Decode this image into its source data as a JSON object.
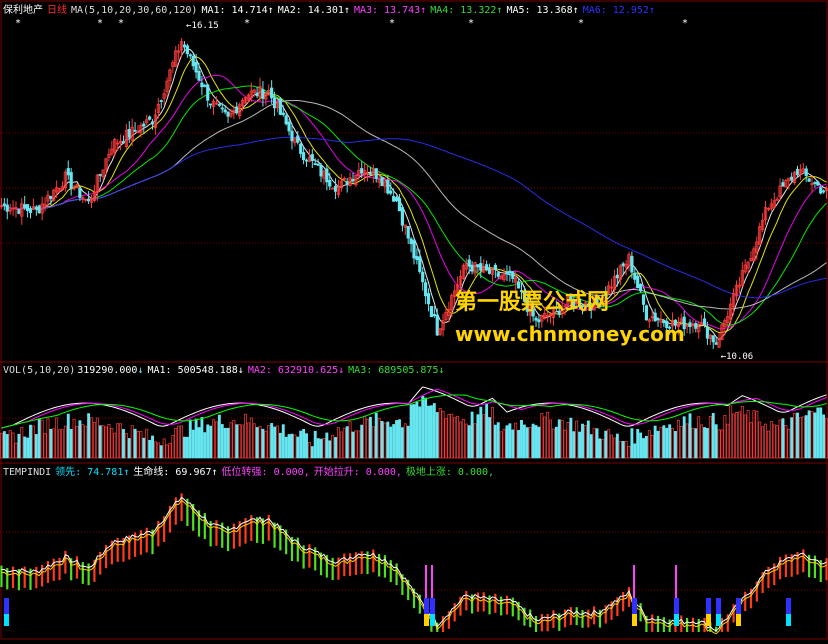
{
  "colors": {
    "background": "#000000",
    "grid": "#7a0000",
    "up": "#ff3b3b",
    "down": "#66e6f0",
    "ma5": "#ffffff",
    "ma10": "#ffff00",
    "ma20": "#ff00ff",
    "ma30": "#00ff00",
    "ma60": "#cccccc",
    "ma120": "#3030ff",
    "vol_up": "#ff3b3b",
    "vol_down": "#66e6f0",
    "ind_red": "#ff3b1a",
    "ind_green": "#50e020",
    "ind_yellow": "#ffd000",
    "white": "#ffffff",
    "cyan": "#00e0ff",
    "magenta": "#ff40ff",
    "green": "#33dd33",
    "watermark": "#ffd400"
  },
  "price_panel": {
    "stock_name": "保利地产",
    "period": "日线",
    "ma_label": "MA(5,10,20,30,60,120)",
    "ma_values": [
      {
        "label": "MA1:",
        "value": "14.714",
        "arrow": "↑",
        "color": "#ffffff"
      },
      {
        "label": "MA2:",
        "value": "14.301",
        "arrow": "↑",
        "color": "#ffffff"
      },
      {
        "label": "MA3:",
        "value": "13.743",
        "arrow": "↑",
        "color": "#ff40ff"
      },
      {
        "label": "MA4:",
        "value": "13.322",
        "arrow": "↑",
        "color": "#33dd33"
      },
      {
        "label": "MA5:",
        "value": "13.368",
        "arrow": "↑",
        "color": "#ffffff"
      },
      {
        "label": "MA6:",
        "value": "12.952",
        "arrow": "↑",
        "color": "#3030ff"
      }
    ],
    "high_label": "16.15",
    "low_label": "10.06"
  },
  "volume_panel": {
    "label": "VOL(5,10,20)",
    "value": "319290.000",
    "arrow": "↓",
    "ma_values": [
      {
        "label": "MA1:",
        "value": "500548.188",
        "arrow": "↓",
        "color": "#ffffff"
      },
      {
        "label": "MA2:",
        "value": "632910.625",
        "arrow": "↓",
        "color": "#ff40ff"
      },
      {
        "label": "MA3:",
        "value": "689505.875",
        "arrow": "↓",
        "color": "#33dd33"
      }
    ]
  },
  "indicator_panel": {
    "label": "TEMPINDI",
    "values": [
      {
        "label": "领先:",
        "value": "74.781",
        "arrow": "↑",
        "color": "#00e0ff"
      },
      {
        "label": "生命线:",
        "value": "69.967",
        "arrow": "↑",
        "color": "#ffffff"
      },
      {
        "label": "低位转强:",
        "value": "0.000,",
        "arrow": "",
        "color": "#ff40ff"
      },
      {
        "label": "开始拉升:",
        "value": "0.000,",
        "arrow": "",
        "color": "#ff40ff"
      },
      {
        "label": "极地上涨:",
        "value": "0.000,",
        "arrow": "",
        "color": "#33dd33"
      }
    ]
  },
  "watermark": {
    "line1": "第一股票公式网",
    "line2": "www.chnmoney.com"
  }
}
